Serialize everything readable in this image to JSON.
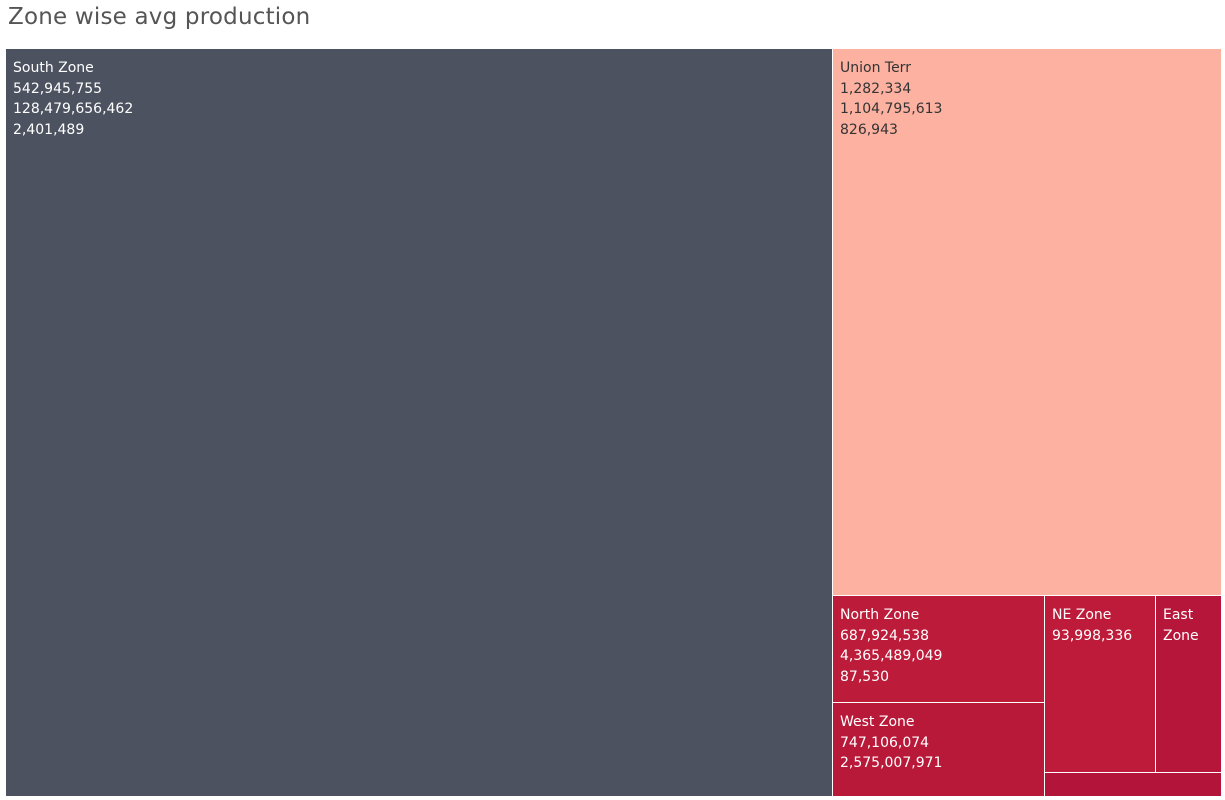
{
  "title": "Zone wise avg production",
  "chart_data": {
    "type": "treemap",
    "cells": [
      {
        "label": "South Zone",
        "values": [
          "542,945,755",
          "128,479,656,462",
          "2,401,489"
        ],
        "color": "#4c5260",
        "text_color": "#ffffff"
      },
      {
        "label": "Union Terr",
        "values": [
          "1,282,334",
          "1,104,795,613",
          "826,943"
        ],
        "color": "#fcb1a1",
        "text_color": "#333333"
      },
      {
        "label": "North Zone",
        "values": [
          "687,924,538",
          "4,365,489,049",
          "87,530"
        ],
        "color": "#bc1b39",
        "text_color": "#ffffff"
      },
      {
        "label": "West Zone",
        "values": [
          "747,106,074",
          "2,575,007,971"
        ],
        "color": "#b91939",
        "text_color": "#ffffff"
      },
      {
        "label": "NE Zone",
        "values": [
          "93,998,336"
        ],
        "color": "#bd1b39",
        "text_color": "#ffffff"
      },
      {
        "label": "East Zone",
        "values": [],
        "color": "#b5163a",
        "text_color": "#ffffff"
      },
      {
        "label": "",
        "values": [],
        "color": "#b21539",
        "text_color": "#ffffff"
      }
    ]
  }
}
